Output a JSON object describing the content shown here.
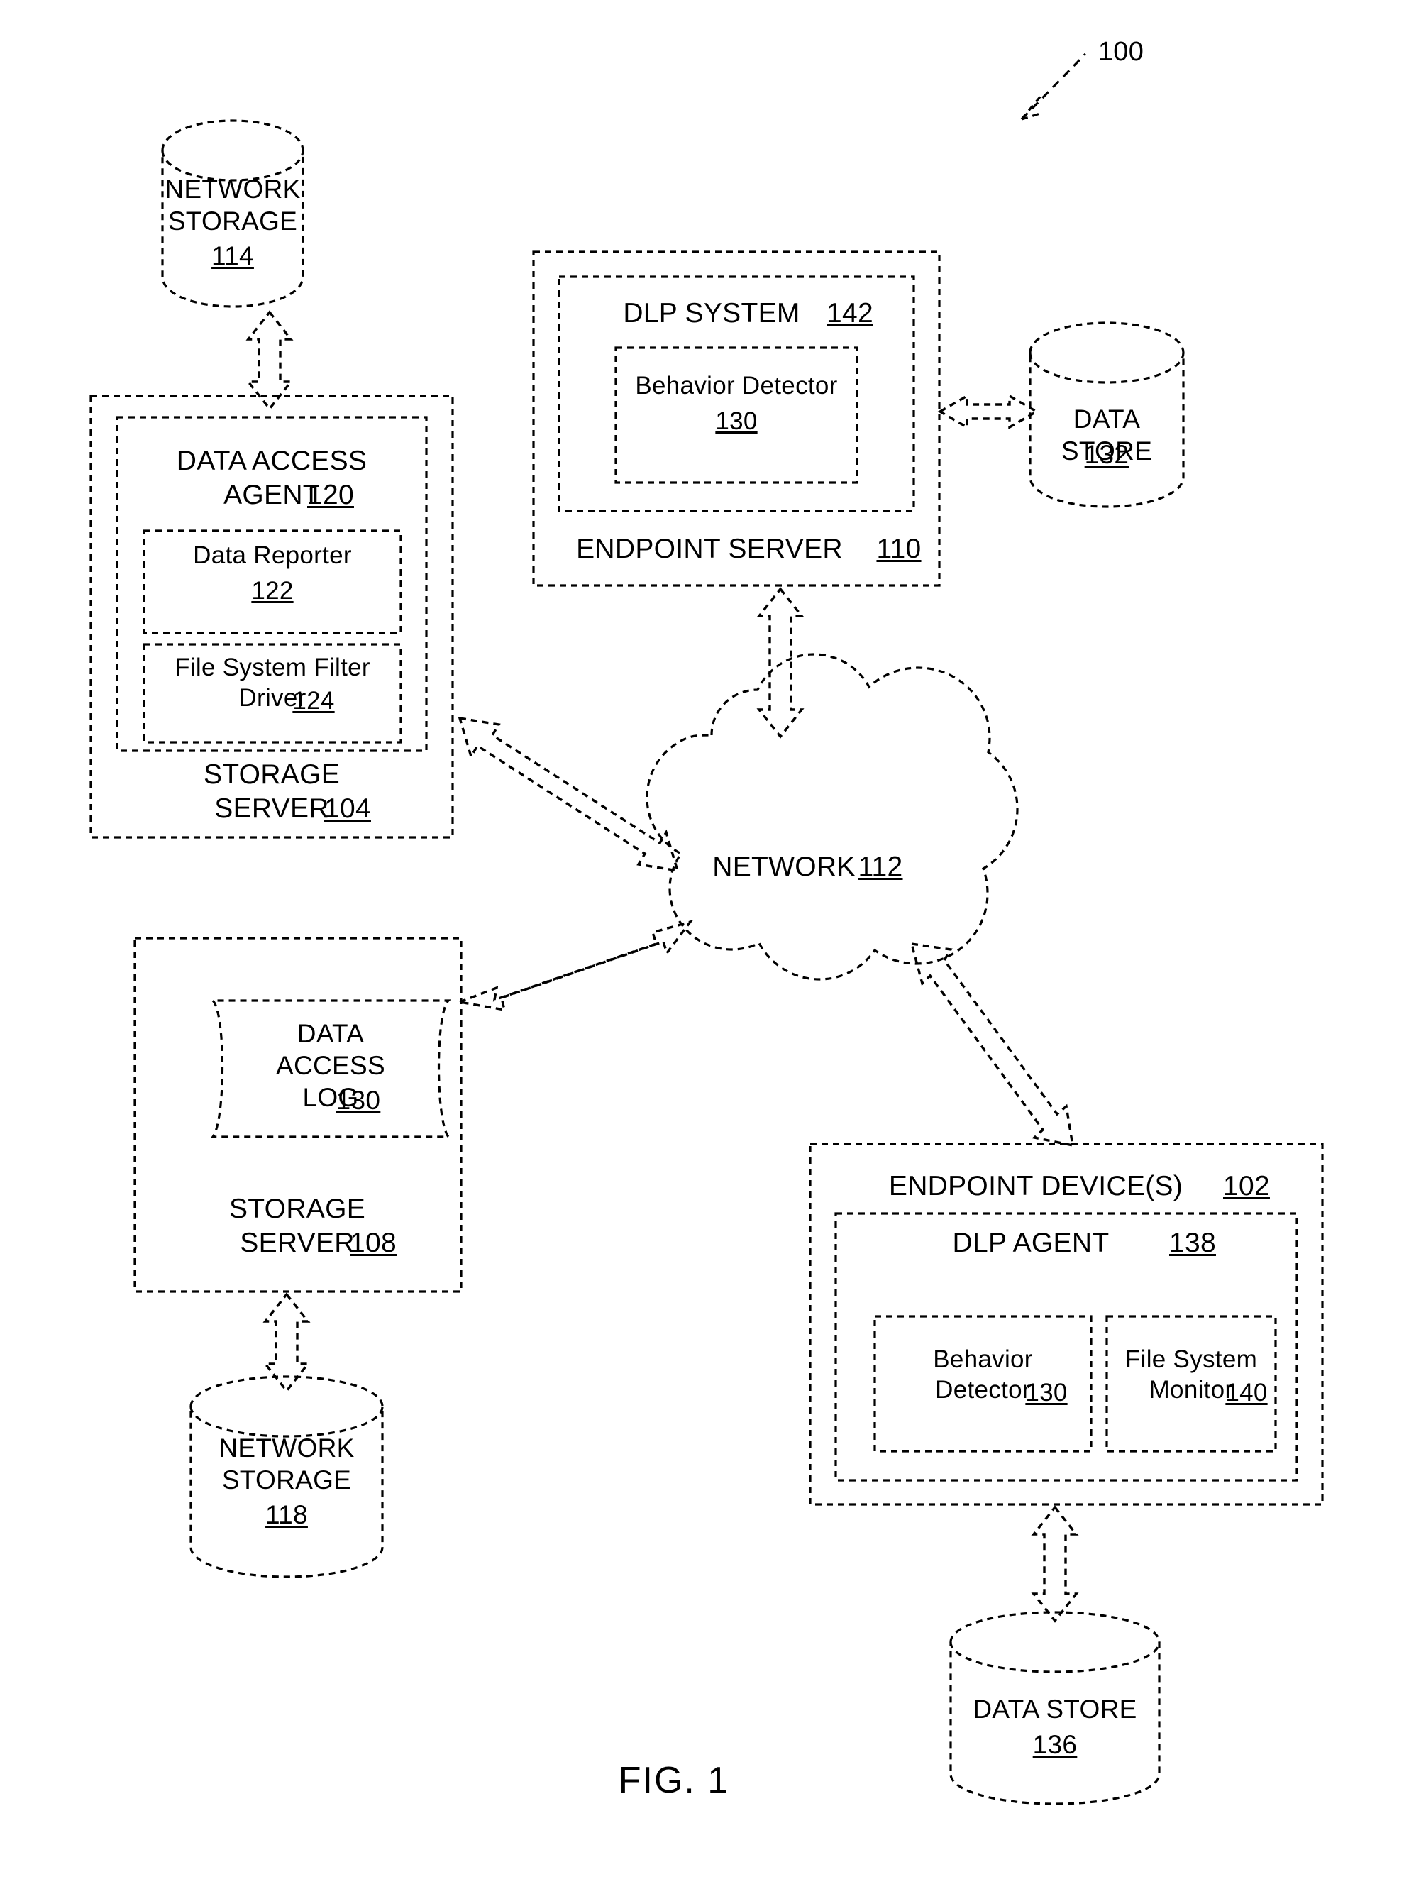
{
  "figure": {
    "caption": "FIG. 1",
    "system_reference": "100"
  },
  "nodes": {
    "network_storage_114": {
      "name": "NETWORK\nSTORAGE",
      "ref": "114",
      "shape": "cylinder"
    },
    "storage_server_104": {
      "name": "STORAGE\nSERVER",
      "ref": "104",
      "shape": "rect"
    },
    "data_access_agent_120": {
      "name": "DATA ACCESS\nAGENT",
      "ref": "120",
      "shape": "rect"
    },
    "data_reporter_122": {
      "name": "Data Reporter",
      "ref": "122",
      "shape": "rect"
    },
    "file_system_filter_driver_124": {
      "name": "File System Filter\nDriver",
      "ref": "124",
      "shape": "rect"
    },
    "endpoint_server_110": {
      "name": "ENDPOINT SERVER",
      "ref": "110",
      "shape": "rect"
    },
    "dlp_system_142": {
      "name": "DLP SYSTEM",
      "ref": "142",
      "shape": "rect"
    },
    "behavior_detector_130_server": {
      "name": "Behavior Detector",
      "ref": "130",
      "shape": "rect"
    },
    "data_store_132": {
      "name": "DATA STORE",
      "ref": "132",
      "shape": "cylinder"
    },
    "network_112": {
      "name": "NETWORK",
      "ref": "112",
      "shape": "cloud"
    },
    "storage_server_108": {
      "name": "STORAGE\nSERVER",
      "ref": "108",
      "shape": "rect"
    },
    "data_access_log_130": {
      "name": "DATA\nACCESS\nLOG",
      "ref": "130",
      "shape": "document"
    },
    "network_storage_118": {
      "name": "NETWORK\nSTORAGE",
      "ref": "118",
      "shape": "cylinder"
    },
    "endpoint_devices_102": {
      "name": "ENDPOINT DEVICE(S)",
      "ref": "102",
      "shape": "rect"
    },
    "dlp_agent_138": {
      "name": "DLP AGENT",
      "ref": "138",
      "shape": "rect"
    },
    "behavior_detector_130_agent": {
      "name": "Behavior\nDetector",
      "ref": "130",
      "shape": "rect"
    },
    "file_system_monitor_140": {
      "name": "File System\nMonitor",
      "ref": "140",
      "shape": "rect"
    },
    "data_store_136": {
      "name": "DATA STORE",
      "ref": "136",
      "shape": "cylinder"
    }
  },
  "connections": [
    {
      "from": "network_storage_114",
      "to": "storage_server_104",
      "style": "double-arrow-vertical"
    },
    {
      "from": "dlp_system_142",
      "to": "data_store_132",
      "style": "double-arrow-horizontal"
    },
    {
      "from": "network_112",
      "to": "endpoint_server_110",
      "style": "double-arrow-vertical"
    },
    {
      "from": "storage_server_104",
      "to": "network_112",
      "style": "double-arrow-diagonal"
    },
    {
      "from": "storage_server_108",
      "to": "network_112",
      "style": "double-arrow-diagonal"
    },
    {
      "from": "network_112",
      "to": "endpoint_devices_102",
      "style": "double-arrow-diagonal"
    },
    {
      "from": "storage_server_108",
      "to": "network_storage_118",
      "style": "double-arrow-vertical"
    },
    {
      "from": "endpoint_devices_102",
      "to": "data_store_136",
      "style": "double-arrow-vertical"
    }
  ]
}
